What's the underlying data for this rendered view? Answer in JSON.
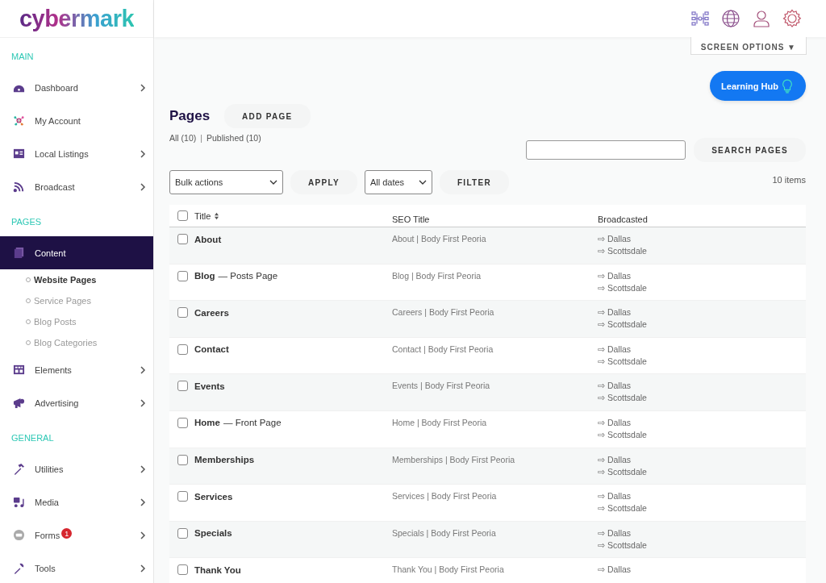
{
  "brand": {
    "logo": "cybermark"
  },
  "sidebar": [
    {
      "heading": "MAIN",
      "items": [
        {
          "label": "Dashboard",
          "kind": "gauge",
          "chevron": true,
          "selected": false
        },
        {
          "label": "My Account",
          "kind": "network",
          "chevron": false,
          "selected": false
        },
        {
          "label": "Local Listings",
          "kind": "card",
          "chevron": true,
          "selected": false
        },
        {
          "label": "Broadcast",
          "kind": "rss",
          "chevron": true,
          "selected": false
        }
      ]
    },
    {
      "heading": "PAGES",
      "items": [
        {
          "label": "Content",
          "kind": "pages",
          "chevron": false,
          "selected": true,
          "children": [
            {
              "label": "Website Pages",
              "selected": true
            },
            {
              "label": "Service Pages",
              "selected": false
            },
            {
              "label": "Blog Posts",
              "selected": false
            },
            {
              "label": "Blog Categories",
              "selected": false
            }
          ]
        },
        {
          "label": "Elements",
          "kind": "grid",
          "chevron": true,
          "selected": false
        },
        {
          "label": "Advertising",
          "kind": "megaphone",
          "chevron": true,
          "selected": false
        }
      ]
    },
    {
      "heading": "GENERAL",
      "items": [
        {
          "label": "Utilities",
          "kind": "hammer",
          "chevron": true,
          "selected": false
        },
        {
          "label": "Media",
          "kind": "media",
          "chevron": true,
          "selected": false
        },
        {
          "label": "Forms",
          "kind": "form",
          "chevron": true,
          "selected": false,
          "badge": "1"
        },
        {
          "label": "Tools",
          "kind": "wrench",
          "chevron": true,
          "selected": false
        }
      ]
    }
  ],
  "screen_options": "SCREEN OPTIONS ▼",
  "learning_hub": "Learning Hub",
  "page_title": "Pages",
  "add_button": "ADD PAGE",
  "filters": [
    {
      "label": "All (10)"
    },
    {
      "separator": "|",
      "label": "Published (10)"
    }
  ],
  "search_button": "SEARCH PAGES",
  "bulk_select": "Bulk actions",
  "apply_button": "APPLY",
  "date_select": "All dates",
  "filter_button": "FILTER",
  "item_count": "10 items",
  "table": {
    "select_all_checked": false,
    "columns": [
      "Title",
      "SEO Title",
      "Broadcasted"
    ],
    "rows": [
      {
        "title": "About",
        "seo": "About | Body First Peoria",
        "broadcast": [
          "⇨ Dallas",
          "⇨ Scottsdale"
        ],
        "checked": false
      },
      {
        "title": "Blog",
        "suffix": "— Posts Page",
        "seo": "Blog | Body First Peoria",
        "broadcast": [
          "⇨ Dallas",
          "⇨ Scottsdale"
        ],
        "checked": false
      },
      {
        "title": "Careers",
        "seo": "Careers | Body First Peoria",
        "broadcast": [
          "⇨ Dallas",
          "⇨ Scottsdale"
        ],
        "checked": false
      },
      {
        "title": "Contact",
        "seo": "Contact | Body First Peoria",
        "broadcast": [
          "⇨ Dallas",
          "⇨ Scottsdale"
        ],
        "checked": false
      },
      {
        "title": "Events",
        "seo": "Events | Body First Peoria",
        "broadcast": [
          "⇨ Dallas",
          "⇨ Scottsdale"
        ],
        "checked": false
      },
      {
        "title": "Home",
        "suffix": "— Front Page",
        "seo": "Home | Body First Peoria",
        "broadcast": [
          "⇨ Dallas",
          "⇨ Scottsdale"
        ],
        "checked": false
      },
      {
        "title": "Memberships",
        "seo": "Memberships | Body First Peoria",
        "broadcast": [
          "⇨ Dallas",
          "⇨ Scottsdale"
        ],
        "checked": false
      },
      {
        "title": "Services",
        "seo": "Services | Body First Peoria",
        "broadcast": [
          "⇨ Dallas",
          "⇨ Scottsdale"
        ],
        "checked": false
      },
      {
        "title": "Specials",
        "seo": "Specials | Body First Peoria",
        "broadcast": [
          "⇨ Dallas",
          "⇨ Scottsdale"
        ],
        "checked": false
      },
      {
        "title": "Thank You",
        "seo": "Thank You | Body First Peoria",
        "broadcast": [
          "⇨ Dallas"
        ],
        "checked": false
      }
    ]
  }
}
